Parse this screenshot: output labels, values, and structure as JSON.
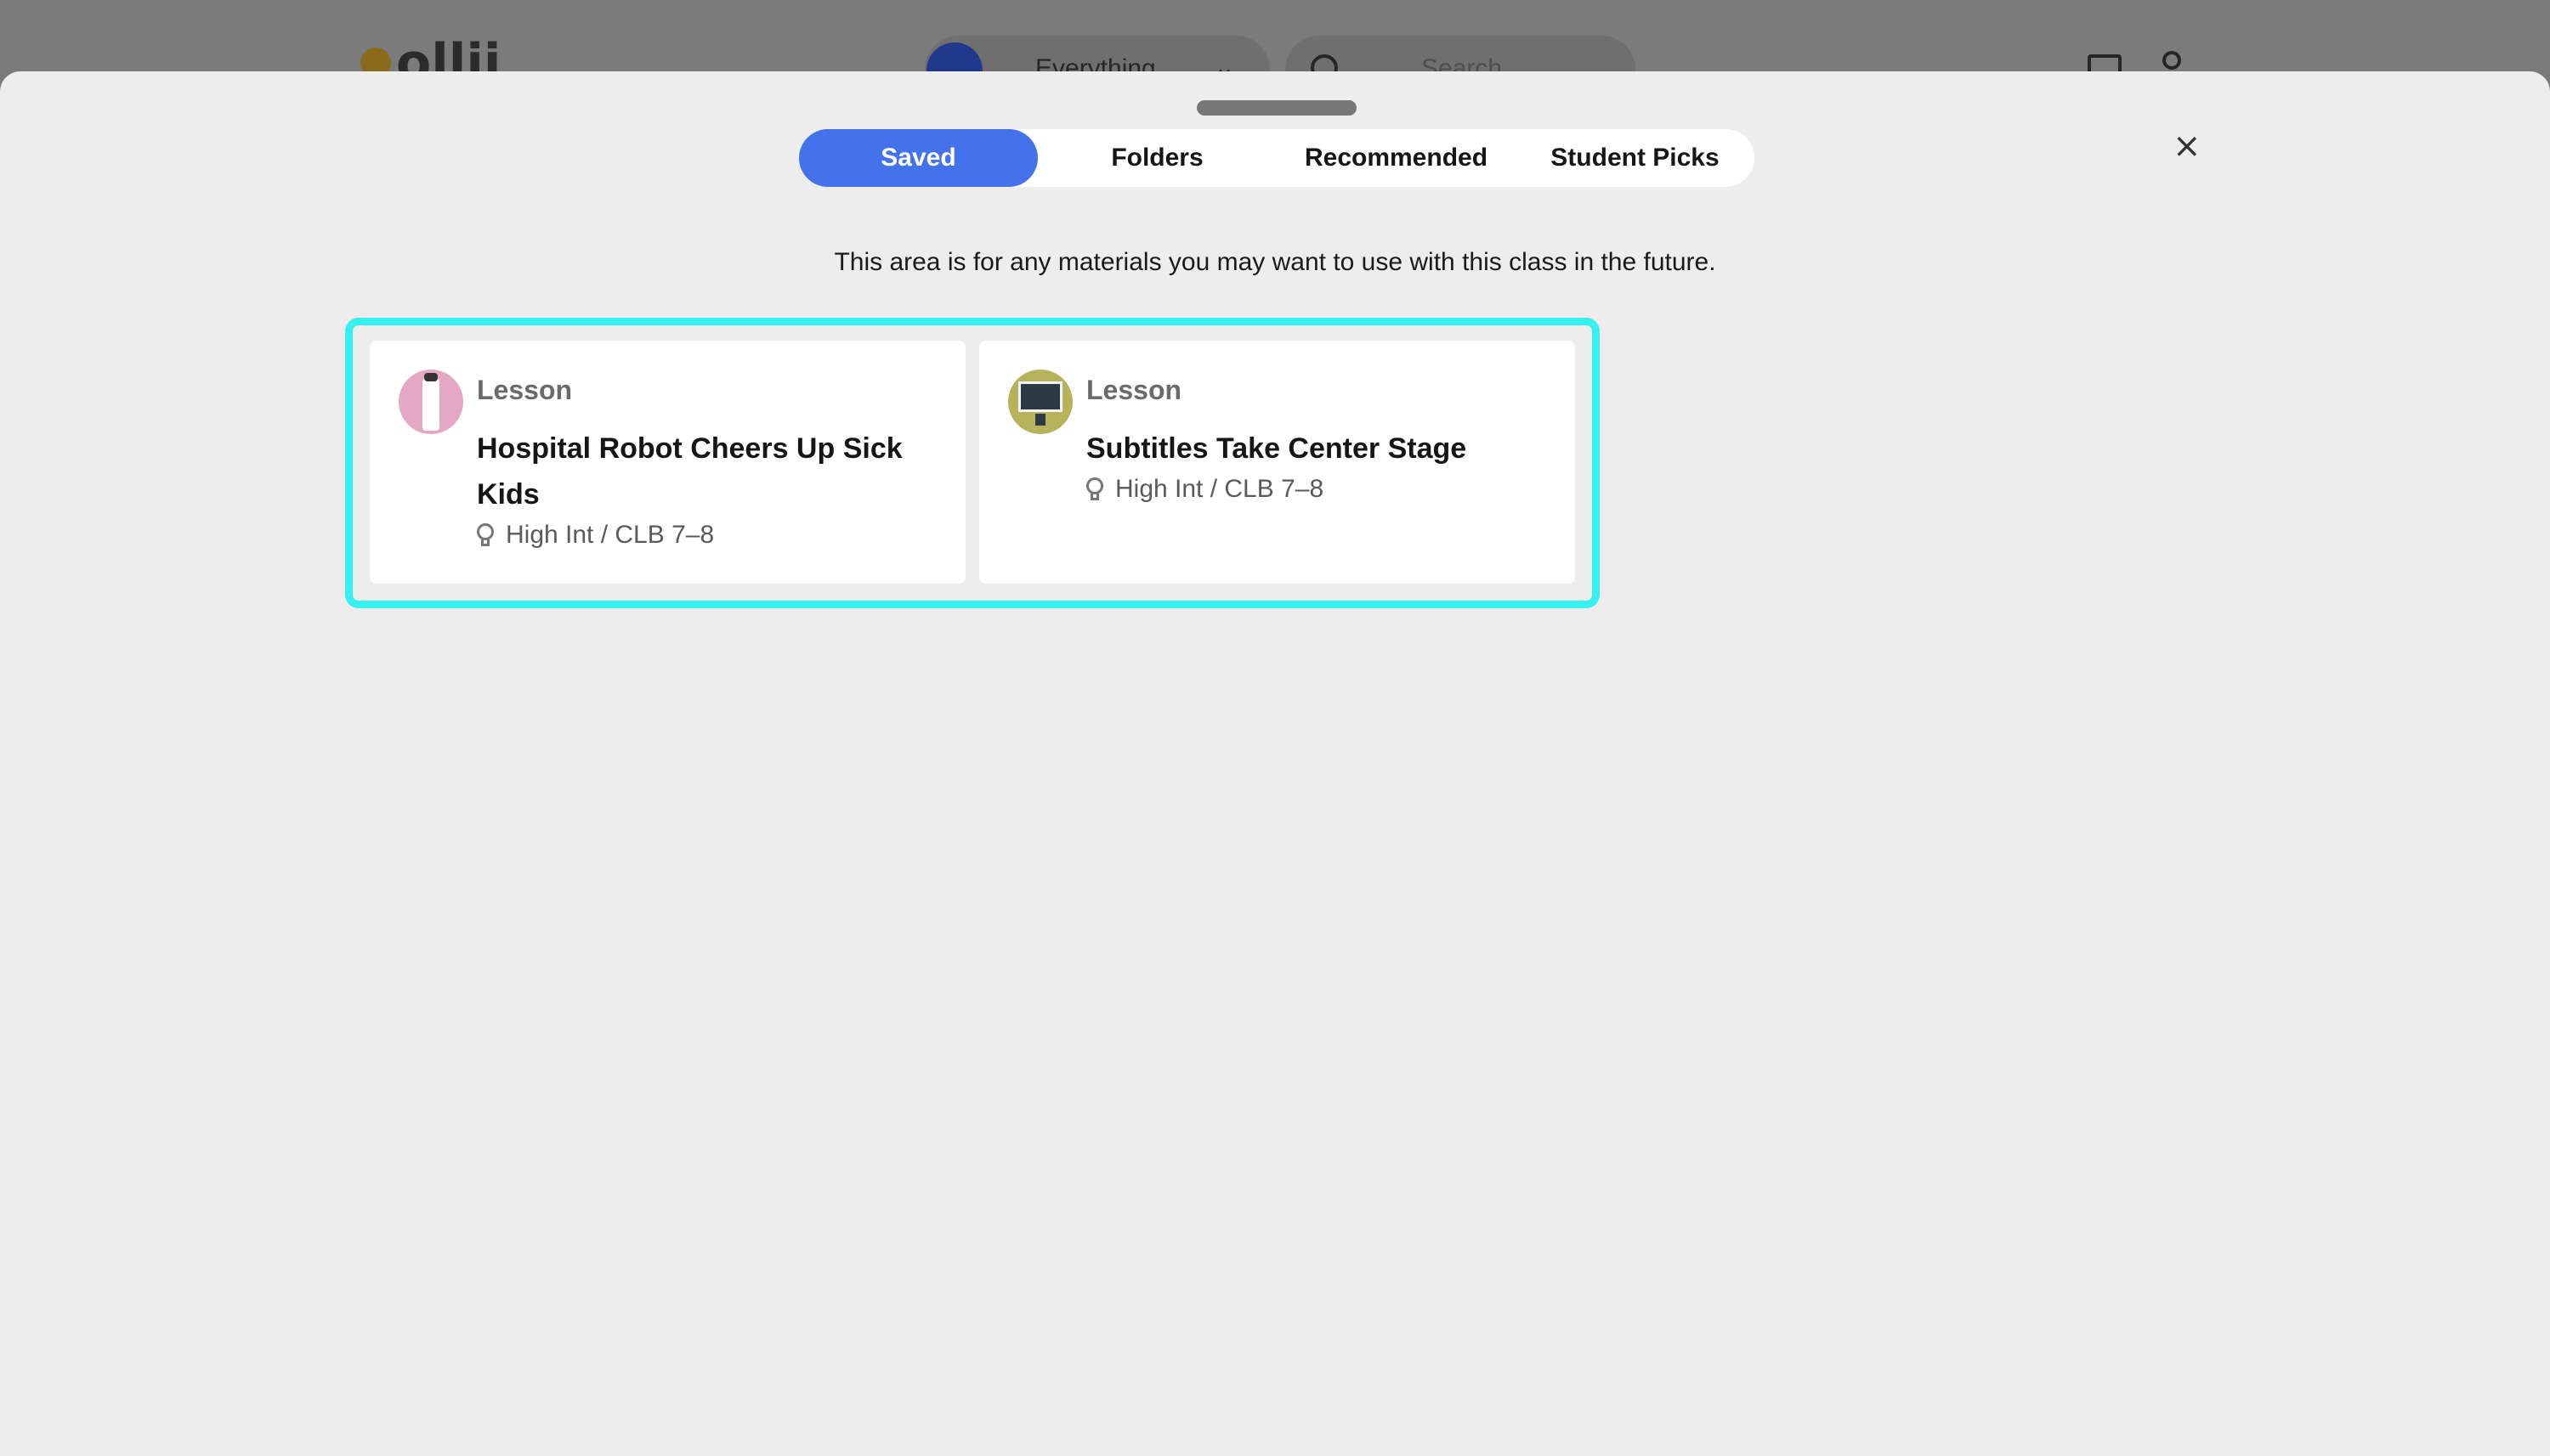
{
  "background": {
    "logo_text": "ollii",
    "filter_label": "Everything",
    "search_placeholder": "Search"
  },
  "tabs": [
    {
      "label": "Saved",
      "active": true
    },
    {
      "label": "Folders",
      "active": false
    },
    {
      "label": "Recommended",
      "active": false
    },
    {
      "label": "Student Picks",
      "active": false
    }
  ],
  "close_label": "×",
  "info_text": "This area is for any materials you may want to use with this class in the future.",
  "cards": [
    {
      "type": "Lesson",
      "title": "Hospital Robot Cheers Up Sick Kids",
      "level": "High Int / CLB 7–8",
      "thumb": "robot-thumbnail"
    },
    {
      "type": "Lesson",
      "title": "Subtitles Take Center Stage",
      "level": "High Int / CLB 7–8",
      "thumb": "screen-thumbnail"
    }
  ],
  "colors": {
    "accent": "#4472ea",
    "highlight": "#37f0f2",
    "sheet_bg": "#ededed"
  }
}
